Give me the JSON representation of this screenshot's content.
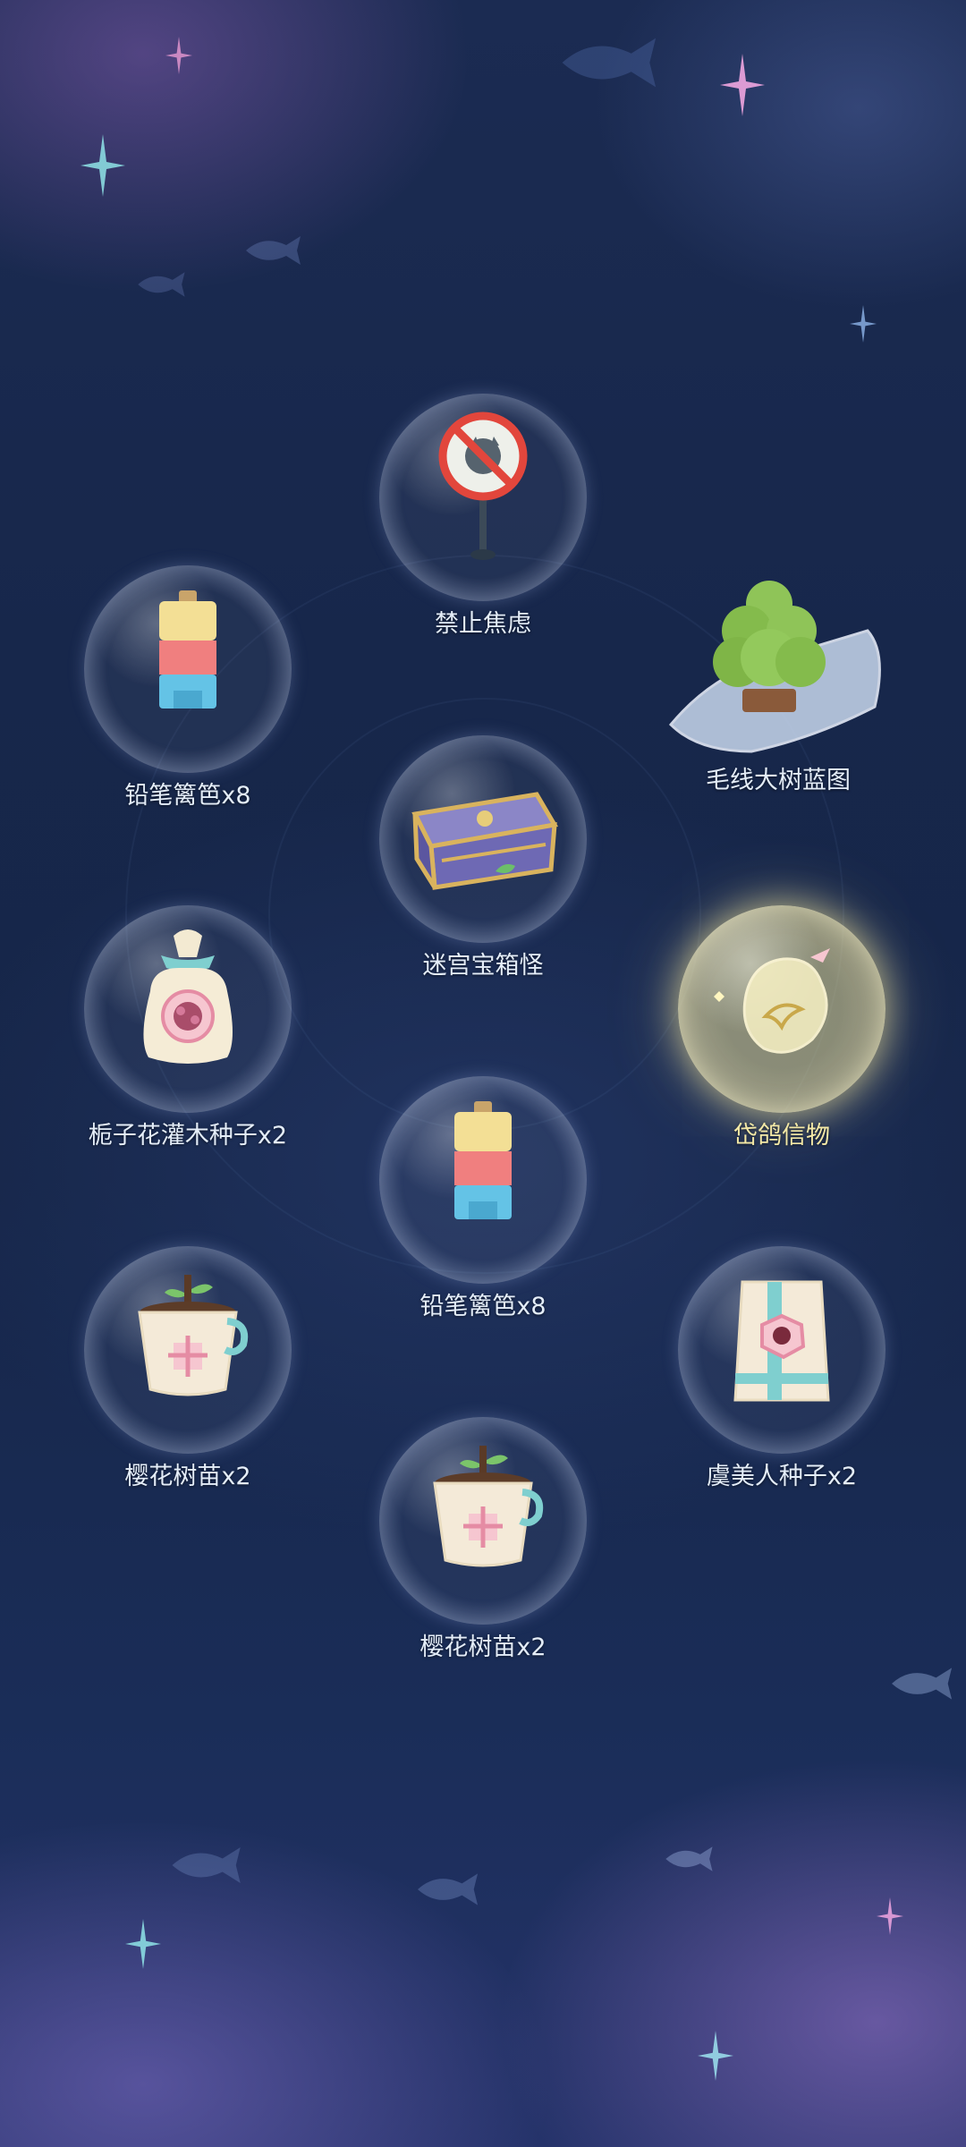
{
  "rewards": [
    {
      "name": "禁止焦虑",
      "icon": "no-anxiety-sign-icon"
    },
    {
      "name": "铅笔篱笆x8",
      "icon": "pencil-fence-icon"
    },
    {
      "name": "毛线大树蓝图",
      "icon": "yarn-tree-blueprint-icon"
    },
    {
      "name": "迷宫宝箱怪",
      "icon": "maze-mimic-chest-icon"
    },
    {
      "name": "栀子花灌木种子x2",
      "icon": "gardenia-seed-bag-icon"
    },
    {
      "name": "岱鸽信物",
      "icon": "dove-token-icon",
      "highlighted": true
    },
    {
      "name": "铅笔篱笆x8",
      "icon": "pencil-fence-icon"
    },
    {
      "name": "樱花树苗x2",
      "icon": "sakura-sapling-icon"
    },
    {
      "name": "虞美人种子x2",
      "icon": "poppy-seed-packet-icon"
    },
    {
      "name": "樱花树苗x2",
      "icon": "sakura-sapling-icon"
    }
  ],
  "colors": {
    "background": "#17274b",
    "label": "#e4edf8",
    "highlight_label": "#f3e8a6",
    "highlight_glow": "#fff0a0"
  }
}
